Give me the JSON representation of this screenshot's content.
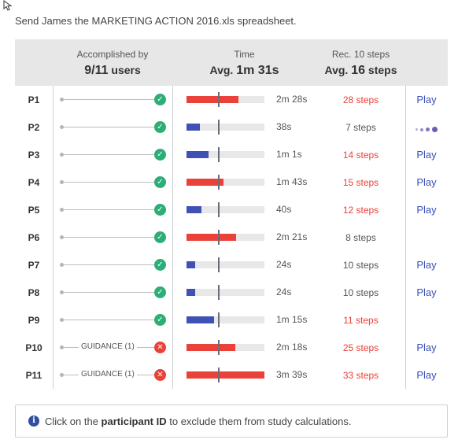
{
  "task": "Send James the MARKETING ACTION 2016.xls spreadsheet.",
  "header": {
    "accomplished_label": "Accomplished by",
    "accomplished_value": "9/11",
    "accomplished_unit": "users",
    "time_label": "Time",
    "time_prefix": "Avg.",
    "time_value": "1m 31s",
    "steps_label": "Rec. 10 steps",
    "steps_prefix": "Avg.",
    "steps_value": "16",
    "steps_unit": "steps"
  },
  "colors": {
    "over": "#ea4138",
    "under": "#3f51b5",
    "success": "#2cae76",
    "fail": "#ea4138",
    "link": "#3a4fb8"
  },
  "rows": [
    {
      "pid": "P1",
      "status": "ok",
      "guidance": "",
      "time": "2m 28s",
      "time_frac": 0.67,
      "time_over": true,
      "steps": "28 steps",
      "steps_over": true,
      "action": "Play"
    },
    {
      "pid": "P2",
      "status": "ok",
      "guidance": "",
      "time": "38s",
      "time_frac": 0.17,
      "time_over": false,
      "steps": "7 steps",
      "steps_over": false,
      "action": "loading"
    },
    {
      "pid": "P3",
      "status": "ok",
      "guidance": "",
      "time": "1m 1s",
      "time_frac": 0.28,
      "time_over": false,
      "steps": "14 steps",
      "steps_over": true,
      "action": "Play"
    },
    {
      "pid": "P4",
      "status": "ok",
      "guidance": "",
      "time": "1m 43s",
      "time_frac": 0.47,
      "time_over": true,
      "steps": "15 steps",
      "steps_over": true,
      "action": "Play"
    },
    {
      "pid": "P5",
      "status": "ok",
      "guidance": "",
      "time": "40s",
      "time_frac": 0.19,
      "time_over": false,
      "steps": "12 steps",
      "steps_over": true,
      "action": "Play"
    },
    {
      "pid": "P6",
      "status": "ok",
      "guidance": "",
      "time": "2m 21s",
      "time_frac": 0.64,
      "time_over": true,
      "steps": "8 steps",
      "steps_over": false,
      "action": ""
    },
    {
      "pid": "P7",
      "status": "ok",
      "guidance": "",
      "time": "24s",
      "time_frac": 0.11,
      "time_over": false,
      "steps": "10 steps",
      "steps_over": false,
      "action": "Play"
    },
    {
      "pid": "P8",
      "status": "ok",
      "guidance": "",
      "time": "24s",
      "time_frac": 0.11,
      "time_over": false,
      "steps": "10 steps",
      "steps_over": false,
      "action": "Play"
    },
    {
      "pid": "P9",
      "status": "ok",
      "guidance": "",
      "time": "1m 15s",
      "time_frac": 0.35,
      "time_over": false,
      "steps": "11 steps",
      "steps_over": true,
      "action": ""
    },
    {
      "pid": "P10",
      "status": "fail",
      "guidance": "GUIDANCE (1)",
      "time": "2m 18s",
      "time_frac": 0.63,
      "time_over": true,
      "steps": "25 steps",
      "steps_over": true,
      "action": "Play"
    },
    {
      "pid": "P11",
      "status": "fail",
      "guidance": "GUIDANCE (1)",
      "time": "3m 39s",
      "time_frac": 1.0,
      "time_over": true,
      "steps": "33 steps",
      "steps_over": true,
      "action": "Play"
    }
  ],
  "info": {
    "before": "Click on the",
    "bold": "participant ID",
    "after": "to exclude them from study calculations."
  }
}
